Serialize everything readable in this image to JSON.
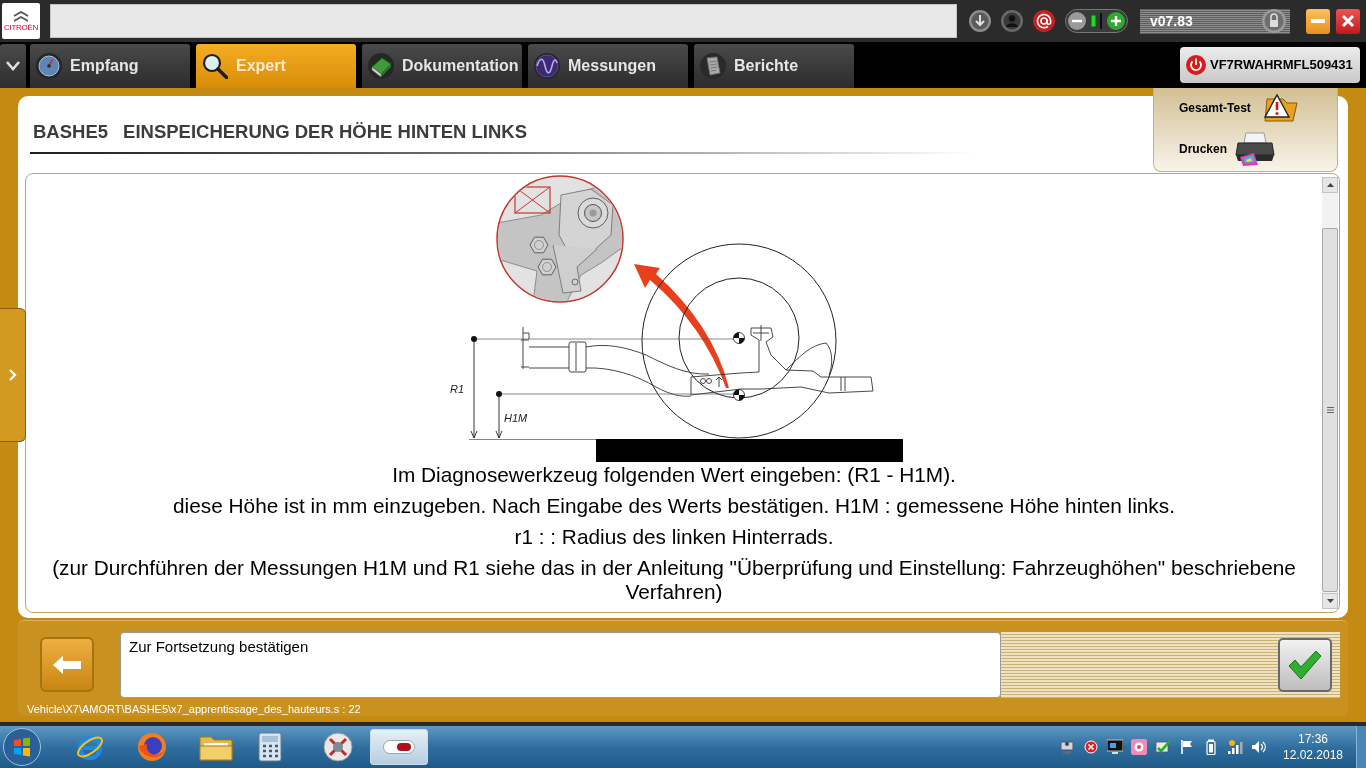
{
  "app_bar": {
    "logo_text": "CITROËN",
    "version": "v07.83"
  },
  "tabs": [
    {
      "label": "Empfang",
      "selected": false
    },
    {
      "label": "Expert",
      "selected": true
    },
    {
      "label": "Dokumentation",
      "selected": false
    },
    {
      "label": "Messungen",
      "selected": false
    },
    {
      "label": "Berichte",
      "selected": false
    }
  ],
  "vehicle": {
    "vin": "VF7RWAHRMFL509431"
  },
  "side_menu": [
    {
      "label": "Gesamt-Test"
    },
    {
      "label": "Drucken"
    }
  ],
  "page": {
    "code": "BASHE5",
    "title": "EINSPEICHERUNG DER HÖHE HINTEN LINKS"
  },
  "figure": {
    "labels": [
      "R1",
      "H1M"
    ]
  },
  "instructions": [
    "Im Diagnosewerkzeug folgenden Wert eingeben: (R1 - H1M).",
    "diese Höhe ist in mm einzugeben. Nach Eingabe des Werts bestätigen. H1M : gemessene Höhe hinten links.",
    "r1 : : Radius des linken Hinterrads.",
    "(zur Durchführen der Messungen H1M und R1 siehe das in der Anleitung \"Überprüfung und Einstellung: Fahrzeughöhen\" beschriebene Verfahren)"
  ],
  "prompt": {
    "message": "Zur Fortsetzung bestätigen"
  },
  "script_path": "Vehicle\\X7\\AMORT\\BASHE5\\x7_apprentissage_des_hauteurs.s : 22",
  "taskbar": {
    "time": "17:36",
    "date": "12.02.2018"
  }
}
